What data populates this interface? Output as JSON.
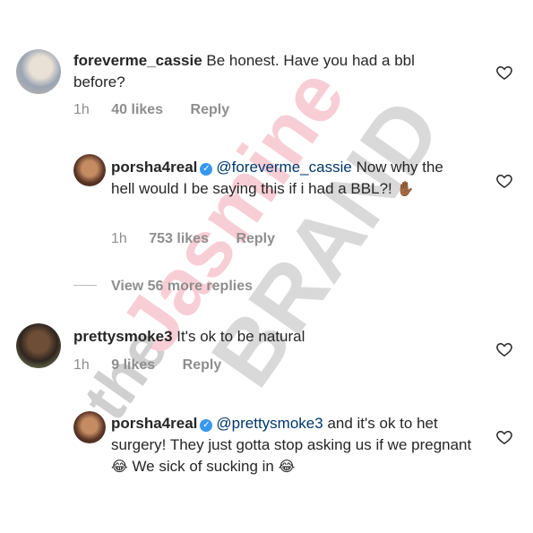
{
  "comments": [
    {
      "username": "foreverme_cassie",
      "body": "Be honest. Have you had a bbl before?",
      "time": "1h",
      "likes": "40 likes",
      "reply": "Reply"
    },
    {
      "username": "porsha4real",
      "mention": "@foreverme_cassie",
      "body": "Now why the hell would I be saying this if i had a BBL?!",
      "emoji_hand": "✋🏾",
      "time": "1h",
      "likes": "753 likes",
      "reply": "Reply"
    },
    {
      "view_more": "View 56 more replies"
    },
    {
      "username": "prettysmoke3",
      "body": "It's ok to be natural",
      "time": "1h",
      "likes": "9 likes",
      "reply": "Reply"
    },
    {
      "username": "porsha4real",
      "mention": "@prettysmoke3",
      "body": "and it's ok to het surgery! They just gotta stop asking us if we pregnant",
      "body_after": "We sick of sucking in",
      "emoji_laugh": "😂",
      "time": "",
      "likes": "",
      "reply": ""
    }
  ],
  "watermark": {
    "line1": "the",
    "line2": "Jasmine",
    "line3": "BRAND"
  },
  "colors": {
    "text": "#262626",
    "meta": "#8e8e8e",
    "mention": "#00376b",
    "verified": "#3897f0",
    "watermark_pink": "#f4b5c0",
    "watermark_gray": "#c8c8c8"
  },
  "icons": [
    "heart-icon",
    "verified-badge-icon"
  ]
}
